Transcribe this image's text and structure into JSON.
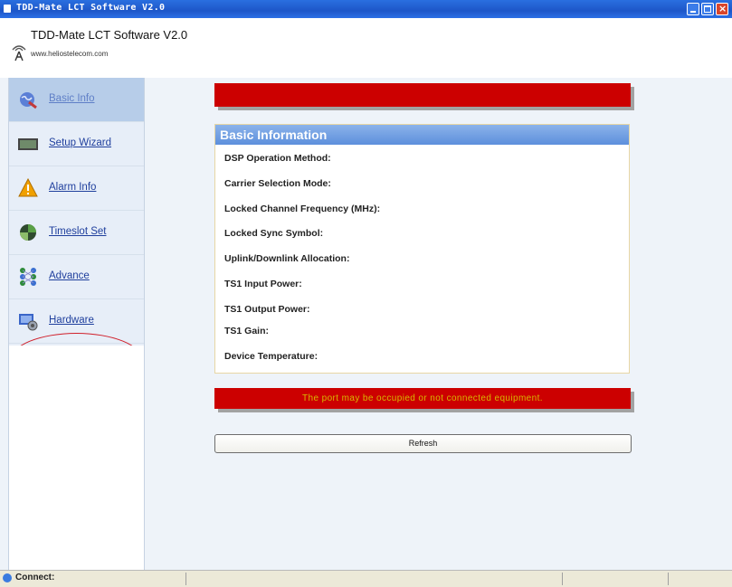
{
  "window": {
    "title": "TDD-Mate LCT Software V2.0"
  },
  "header": {
    "app_name": "TDD-Mate LCT Software V2.0",
    "url": "www.heliostelecom.com"
  },
  "sidebar": {
    "items": [
      {
        "label": "Basic Info",
        "icon": "globe-icon",
        "active": true
      },
      {
        "label": "Setup Wizard",
        "icon": "setup-icon",
        "active": false
      },
      {
        "label": "Alarm Info",
        "icon": "warning-icon",
        "active": false
      },
      {
        "label": "Timeslot Set",
        "icon": "timeslot-icon",
        "active": false
      },
      {
        "label": "Advance",
        "icon": "advance-icon",
        "active": false
      },
      {
        "label": "Hardware",
        "icon": "hardware-icon",
        "active": false
      }
    ]
  },
  "main": {
    "panel_title": "Basic Information",
    "fields": [
      "DSP Operation Method:",
      "Carrier Selection Mode:",
      "Locked Channel Frequency (MHz):",
      "Locked Sync Symbol:",
      "Uplink/Downlink Allocation:",
      "TS1 Input Power:",
      "TS1 Output Power:",
      "TS1 Gain:",
      "Device Temperature:"
    ],
    "error_message": "The port may be occupied or not connected equipment.",
    "refresh_label": "Refresh"
  },
  "statusbar": {
    "text": "Connect:"
  },
  "colors": {
    "error_bar": "#cc0000",
    "error_text": "#d8b800",
    "panel_header": "#6b9be2",
    "highlight": "#d0202b"
  }
}
